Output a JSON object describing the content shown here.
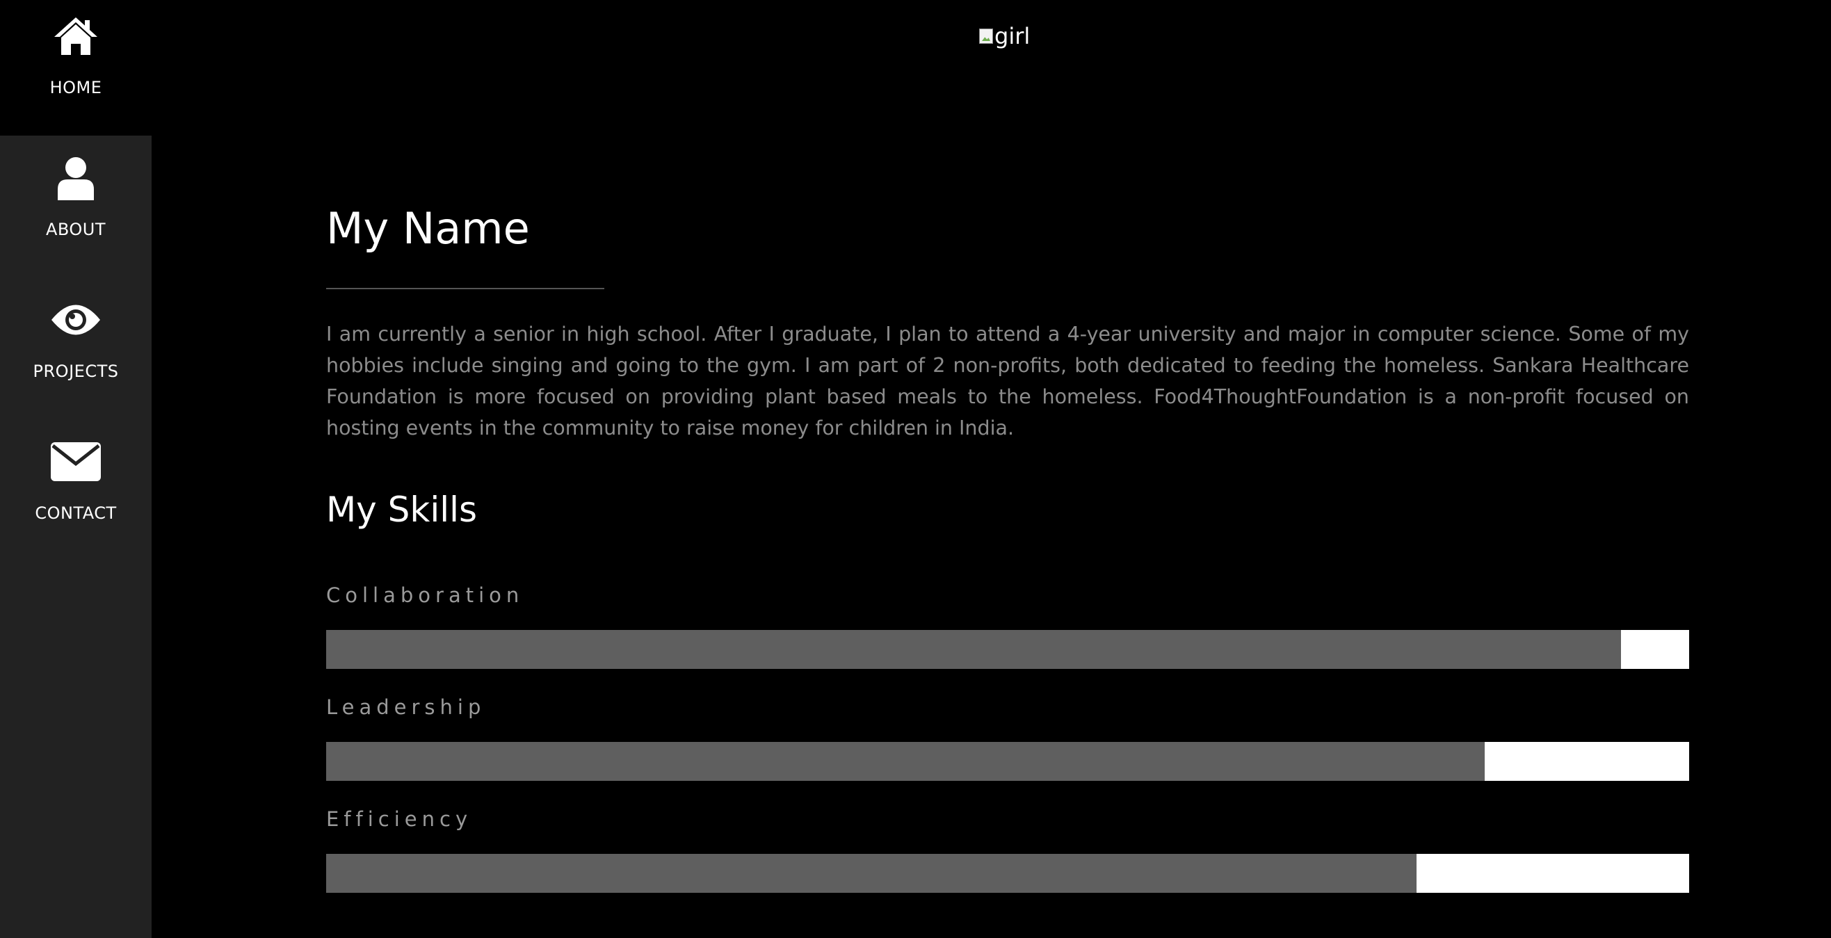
{
  "nav": {
    "items": [
      {
        "label": "HOME",
        "icon": "home-icon",
        "active": true
      },
      {
        "label": "ABOUT",
        "icon": "user-icon",
        "active": false
      },
      {
        "label": "PROJECTS",
        "icon": "eye-icon",
        "active": false
      },
      {
        "label": "CONTACT",
        "icon": "envelope-icon",
        "active": false
      }
    ]
  },
  "hero": {
    "image_alt": "girl"
  },
  "about": {
    "title": "My Name",
    "bio": "I am currently a senior in high school. After I graduate, I plan to attend a 4-year university and major in computer science. Some of my hobbies include singing and going to the gym. I am part of 2 non-profits, both dedicated to feeding the homeless. Sankara Healthcare Foundation is more focused on providing plant based meals to the homeless. Food4ThoughtFoundation is a non-profit focused on hosting events in the community to raise money for children in India."
  },
  "skills": {
    "title": "My Skills",
    "items": [
      {
        "label": "Collaboration",
        "level_percent": 95
      },
      {
        "label": "Leadership",
        "level_percent": 85
      },
      {
        "label": "Efficiency",
        "level_percent": 80
      }
    ]
  },
  "colors": {
    "background": "#000000",
    "sidebar": "#222222",
    "bar_fill": "#5f5f5f",
    "bar_track": "#ffffff",
    "body_text": "#8c8c8c"
  }
}
